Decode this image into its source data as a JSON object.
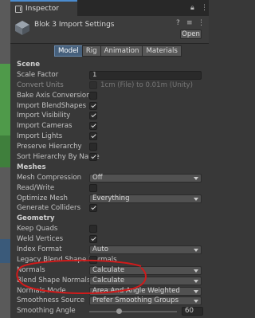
{
  "window": {
    "tab_label": "Inspector"
  },
  "asset": {
    "title": "Blok 3 Import Settings",
    "open_label": "Open"
  },
  "tabs": [
    {
      "label": "Model"
    },
    {
      "label": "Rig"
    },
    {
      "label": "Animation"
    },
    {
      "label": "Materials"
    }
  ],
  "rows": [
    {
      "kind": "header",
      "label": "Scene"
    },
    {
      "kind": "input",
      "label": "Scale Factor",
      "value": "1"
    },
    {
      "kind": "checkbox",
      "label": "Convert Units",
      "checked": false,
      "dim": true,
      "extra": "1cm (File) to 0.01m (Unity)"
    },
    {
      "kind": "checkbox",
      "label": "Bake Axis Conversion",
      "checked": false
    },
    {
      "kind": "checkbox",
      "label": "Import BlendShapes",
      "checked": true
    },
    {
      "kind": "checkbox",
      "label": "Import Visibility",
      "checked": true
    },
    {
      "kind": "checkbox",
      "label": "Import Cameras",
      "checked": true
    },
    {
      "kind": "checkbox",
      "label": "Import Lights",
      "checked": true
    },
    {
      "kind": "checkbox",
      "label": "Preserve Hierarchy",
      "checked": false
    },
    {
      "kind": "checkbox",
      "label": "Sort Hierarchy By Name",
      "checked": true
    },
    {
      "kind": "header",
      "label": "Meshes"
    },
    {
      "kind": "dropdown",
      "label": "Mesh Compression",
      "value": "Off"
    },
    {
      "kind": "checkbox",
      "label": "Read/Write",
      "checked": false
    },
    {
      "kind": "dropdown",
      "label": "Optimize Mesh",
      "value": "Everything"
    },
    {
      "kind": "checkbox",
      "label": "Generate Colliders",
      "checked": true
    },
    {
      "kind": "header",
      "label": "Geometry"
    },
    {
      "kind": "checkbox",
      "label": "Keep Quads",
      "checked": false
    },
    {
      "kind": "checkbox",
      "label": "Weld Vertices",
      "checked": true
    },
    {
      "kind": "dropdown",
      "label": "Index Format",
      "value": "Auto"
    },
    {
      "kind": "checkbox",
      "label": "Legacy Blend Shape Normals",
      "checked": false
    },
    {
      "kind": "dropdown",
      "label": "Normals",
      "value": "Calculate"
    },
    {
      "kind": "dropdown",
      "label": "Blend Shape Normals",
      "value": "Calculate"
    },
    {
      "kind": "dropdown",
      "label": "Normals Mode",
      "value": "Area And Angle Weighted"
    },
    {
      "kind": "dropdown",
      "label": "Smoothness Source",
      "value": "Prefer Smoothing Groups"
    },
    {
      "kind": "slider",
      "label": "Smoothing Angle",
      "value": "60",
      "fraction": 0.333
    }
  ],
  "colors": {
    "accent": "#4b8ccf",
    "annotation": "#d11a1a"
  },
  "icons": [
    "inspector-icon",
    "lock-icon",
    "menu-icon",
    "cube-icon",
    "help-icon",
    "settings-icon",
    "preset-icon",
    "dropdown-arrow-icon",
    "checkmark-icon"
  ]
}
